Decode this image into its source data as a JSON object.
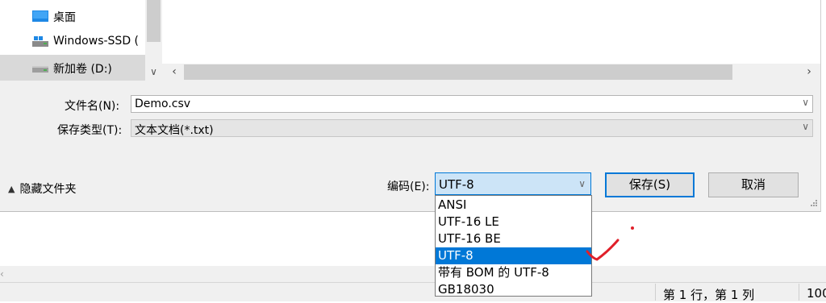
{
  "nav": {
    "items": [
      {
        "label": "桌面",
        "icon": "desktop-icon"
      },
      {
        "label": "Windows-SSD (",
        "icon": "drive-icon"
      },
      {
        "label": "新加卷 (D:)",
        "icon": "drive-icon"
      }
    ]
  },
  "form": {
    "filename_label": "文件名(N):",
    "filename_value": "Demo.csv",
    "type_label": "保存类型(T):",
    "type_value": "文本文档(*.txt)",
    "encoding_label": "编码(E):",
    "encoding_value": "UTF-8"
  },
  "buttons": {
    "hide_folders": "隐藏文件夹",
    "save": "保存(S)",
    "cancel": "取消"
  },
  "dropdown": {
    "options": [
      "ANSI",
      "UTF-16 LE",
      "UTF-16 BE",
      "UTF-8",
      "带有 BOM 的 UTF-8",
      "GB18030"
    ],
    "selected": "UTF-8"
  },
  "status": {
    "position": "第 1 行，第 1 列",
    "zoom": "100"
  },
  "colors": {
    "accent": "#0078d7",
    "annotation": "#e0202a"
  }
}
